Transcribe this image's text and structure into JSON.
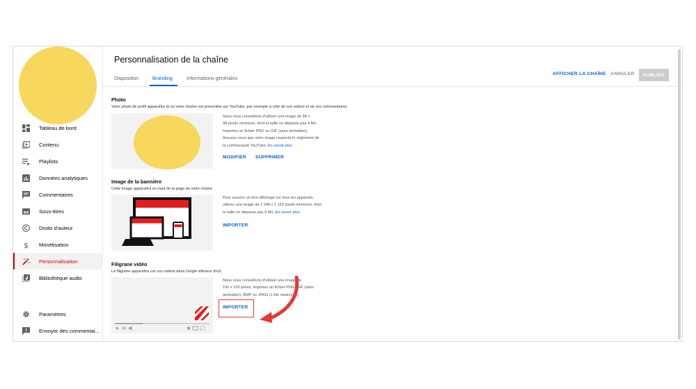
{
  "sidebar": {
    "items": [
      {
        "label": "Tableau de bord",
        "icon": "dashboard-icon"
      },
      {
        "label": "Contenu",
        "icon": "content-icon"
      },
      {
        "label": "Playlists",
        "icon": "playlist-icon"
      },
      {
        "label": "Données analytiques",
        "icon": "analytics-icon"
      },
      {
        "label": "Commentaires",
        "icon": "comments-icon"
      },
      {
        "label": "Sous-titres",
        "icon": "subtitles-icon"
      },
      {
        "label": "Droits d'auteur",
        "icon": "copyright-icon"
      },
      {
        "label": "Monétisation",
        "icon": "dollar-icon"
      },
      {
        "label": "Personnalisation",
        "icon": "magic-wand-icon"
      },
      {
        "label": "Bibliothèque audio",
        "icon": "audio-library-icon"
      }
    ],
    "footer": [
      {
        "label": "Paramètres",
        "icon": "gear-icon"
      },
      {
        "label": "Envoyer des commentai...",
        "icon": "feedback-icon"
      }
    ],
    "active_index": 8
  },
  "header": {
    "title": "Personnalisation de la chaîne",
    "tabs": [
      {
        "label": "Disposition"
      },
      {
        "label": "Branding"
      },
      {
        "label": "Informations générales"
      }
    ],
    "active_tab": 1,
    "view_channel": "AFFICHER LA CHAÎNE",
    "cancel": "ANNULER",
    "publish": "PUBLIER"
  },
  "photo": {
    "title": "Photo",
    "description": "Votre photo de profil apparaîtra là où votre chaîne est présentée sur YouTube, par exemple à côté de vos vidéos et de vos commentaires",
    "lines": [
      "Nous vous conseillons d'utiliser une image de 98 x",
      "98 pixels minimum, dont la taille ne dépasse pas 4 Mo.",
      "Importez un fichier PNG ou GIF (sans animation).",
      "Assurez-vous que votre image respecte le règlement de",
      "la communauté YouTube."
    ],
    "learn_more": "En savoir plus",
    "modify": "MODIFIER",
    "delete": "SUPPRIMER"
  },
  "banner": {
    "title": "Image de la bannière",
    "description": "Cette image apparaîtra en haut de la page de votre chaîne",
    "lines": [
      "Pour assurer un bon affichage sur tous les appareils,",
      "utilisez une image de 2 048 x 1 152 pixels minimum, dont",
      "la taille ne dépasse pas 6 Mo."
    ],
    "learn_more": "En savoir plus",
    "import": "IMPORTER"
  },
  "watermark": {
    "title": "Filigrane vidéo",
    "description": "Le filigrane apparaîtra sur vos vidéos dans l'angle inférieur droit.",
    "lines": [
      "Nous vous conseillons d'utiliser une image de",
      "150 x 150 pixels. Importez un fichier PNG, GIF (sans",
      "animation), BMP ou JPEG (1 Mo maximum)."
    ],
    "import": "IMPORTER"
  },
  "colors": {
    "accent": "#065fd4",
    "brand_red": "#cc0000",
    "avatar_yellow": "#f7d75c",
    "annotation_red": "#e53935"
  }
}
